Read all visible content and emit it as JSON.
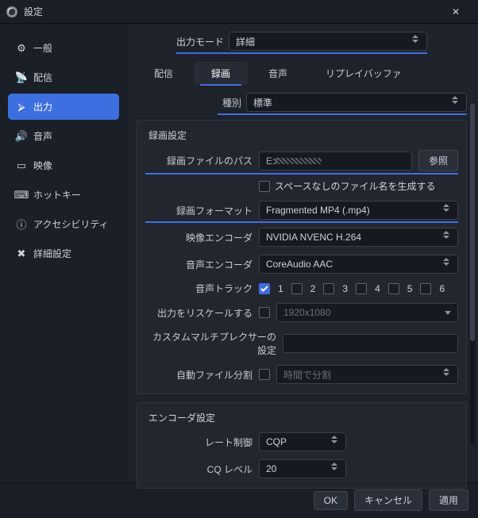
{
  "window": {
    "title": "設定",
    "close_glyph": "✕"
  },
  "sidebar": {
    "items": [
      {
        "label": "一般",
        "icon": "⚙"
      },
      {
        "label": "配信",
        "icon": "📡"
      },
      {
        "label": "出力",
        "icon": "⮚"
      },
      {
        "label": "音声",
        "icon": "🔊"
      },
      {
        "label": "映像",
        "icon": "▭"
      },
      {
        "label": "ホットキー",
        "icon": "⌨"
      },
      {
        "label": "アクセシビリティ",
        "icon": "ⓘ"
      },
      {
        "label": "詳細設定",
        "icon": "✖"
      }
    ],
    "active_index": 2
  },
  "output": {
    "mode_label": "出力モード",
    "mode_value": "詳細",
    "tabs": [
      "配信",
      "録画",
      "音声",
      "リプレイバッファ"
    ],
    "active_tab": 1,
    "type_label": "種別",
    "type_value": "標準",
    "rec": {
      "section_title": "録画設定",
      "path_label": "録画ファイルのパス",
      "path_value": "E:/",
      "browse": "参照",
      "nospace_label": "スペースなしのファイル名を生成する",
      "nospace_checked": false,
      "format_label": "録画フォーマット",
      "format_value": "Fragmented MP4 (.mp4)",
      "venc_label": "映像エンコーダ",
      "venc_value": "NVIDIA NVENC H.264",
      "aenc_label": "音声エンコーダ",
      "aenc_value": "CoreAudio AAC",
      "tracks_label": "音声トラック",
      "tracks": [
        true,
        false,
        false,
        false,
        false,
        false
      ],
      "rescale_label": "出力をリスケールする",
      "rescale_checked": false,
      "rescale_value": "1920x1080",
      "mux_label": "カスタムマルチプレクサーの設定",
      "mux_value": "",
      "autosplit_label": "自動ファイル分割",
      "autosplit_checked": false,
      "autosplit_value": "時間で分割"
    },
    "enc": {
      "section_title": "エンコーダ設定",
      "rate_label": "レート制御",
      "rate_value": "CQP",
      "cq_label": "CQ レベル",
      "cq_value": "20"
    }
  },
  "footer": {
    "ok": "OK",
    "cancel": "キャンセル",
    "apply": "適用"
  }
}
